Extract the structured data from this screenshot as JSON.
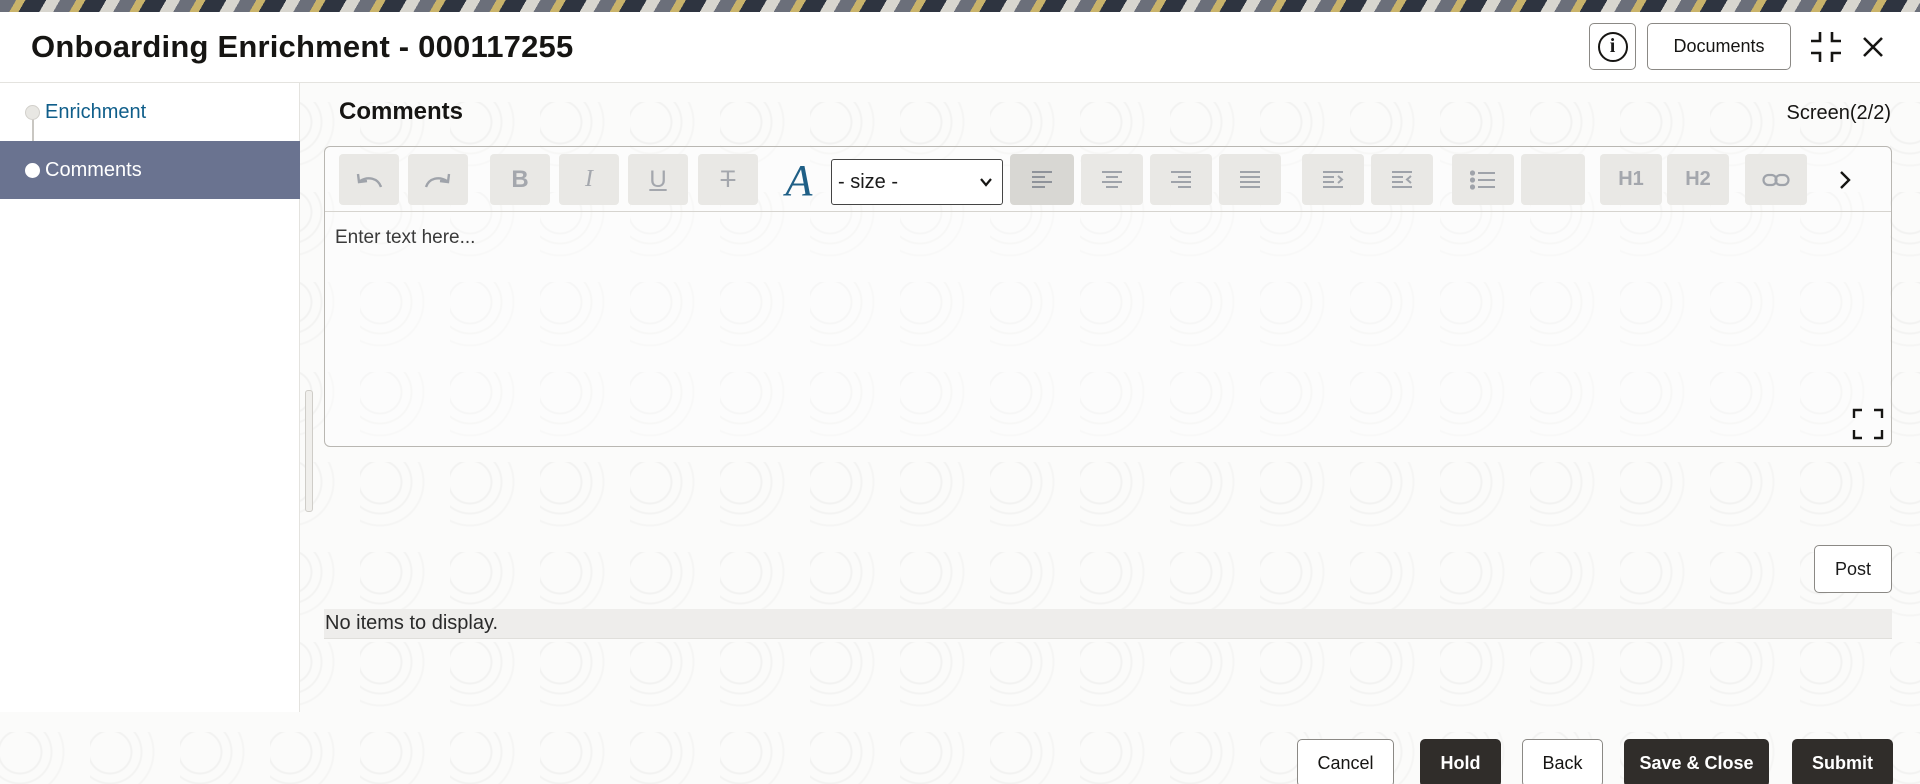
{
  "header": {
    "title": "Onboarding Enrichment - 000117255",
    "info_icon": "info-icon",
    "documents_label": "Documents",
    "minimize_icon": "minimize-icon",
    "close_icon": "close-icon"
  },
  "nav": {
    "items": [
      {
        "label": "Enrichment",
        "active": false
      },
      {
        "label": "Comments",
        "active": true
      }
    ]
  },
  "main": {
    "section_title": "Comments",
    "screen_indicator": "Screen(2/2)"
  },
  "editor": {
    "size_select": {
      "selected": "- size -"
    },
    "placeholder": "Enter text here...",
    "toolbar_icons": [
      "undo-icon",
      "redo-icon",
      "bold-icon",
      "italic-icon",
      "underline-icon",
      "strikethrough-icon",
      "font-color-icon",
      "align-left-icon",
      "align-center-icon",
      "align-right-icon",
      "justify-icon",
      "indent-icon",
      "outdent-icon",
      "bullet-list-icon",
      "h1-icon",
      "h2-icon",
      "link-icon",
      "chevron-right-icon"
    ],
    "bold_glyph": "B",
    "italic_glyph": "I",
    "underline_glyph": "U",
    "strike_glyph": "T",
    "font_glyph": "A",
    "h1_label": "H1",
    "h2_label": "H2"
  },
  "comments": {
    "post_label": "Post",
    "empty_text": "No items to display."
  },
  "footer": {
    "cancel_label": "Cancel",
    "hold_label": "Hold",
    "back_label": "Back",
    "save_close_label": "Save & Close",
    "submit_label": "Submit"
  },
  "colors": {
    "nav_active_bg": "#6a7390",
    "link_blue": "#0f5e8a",
    "dark_button": "#302d2a"
  }
}
